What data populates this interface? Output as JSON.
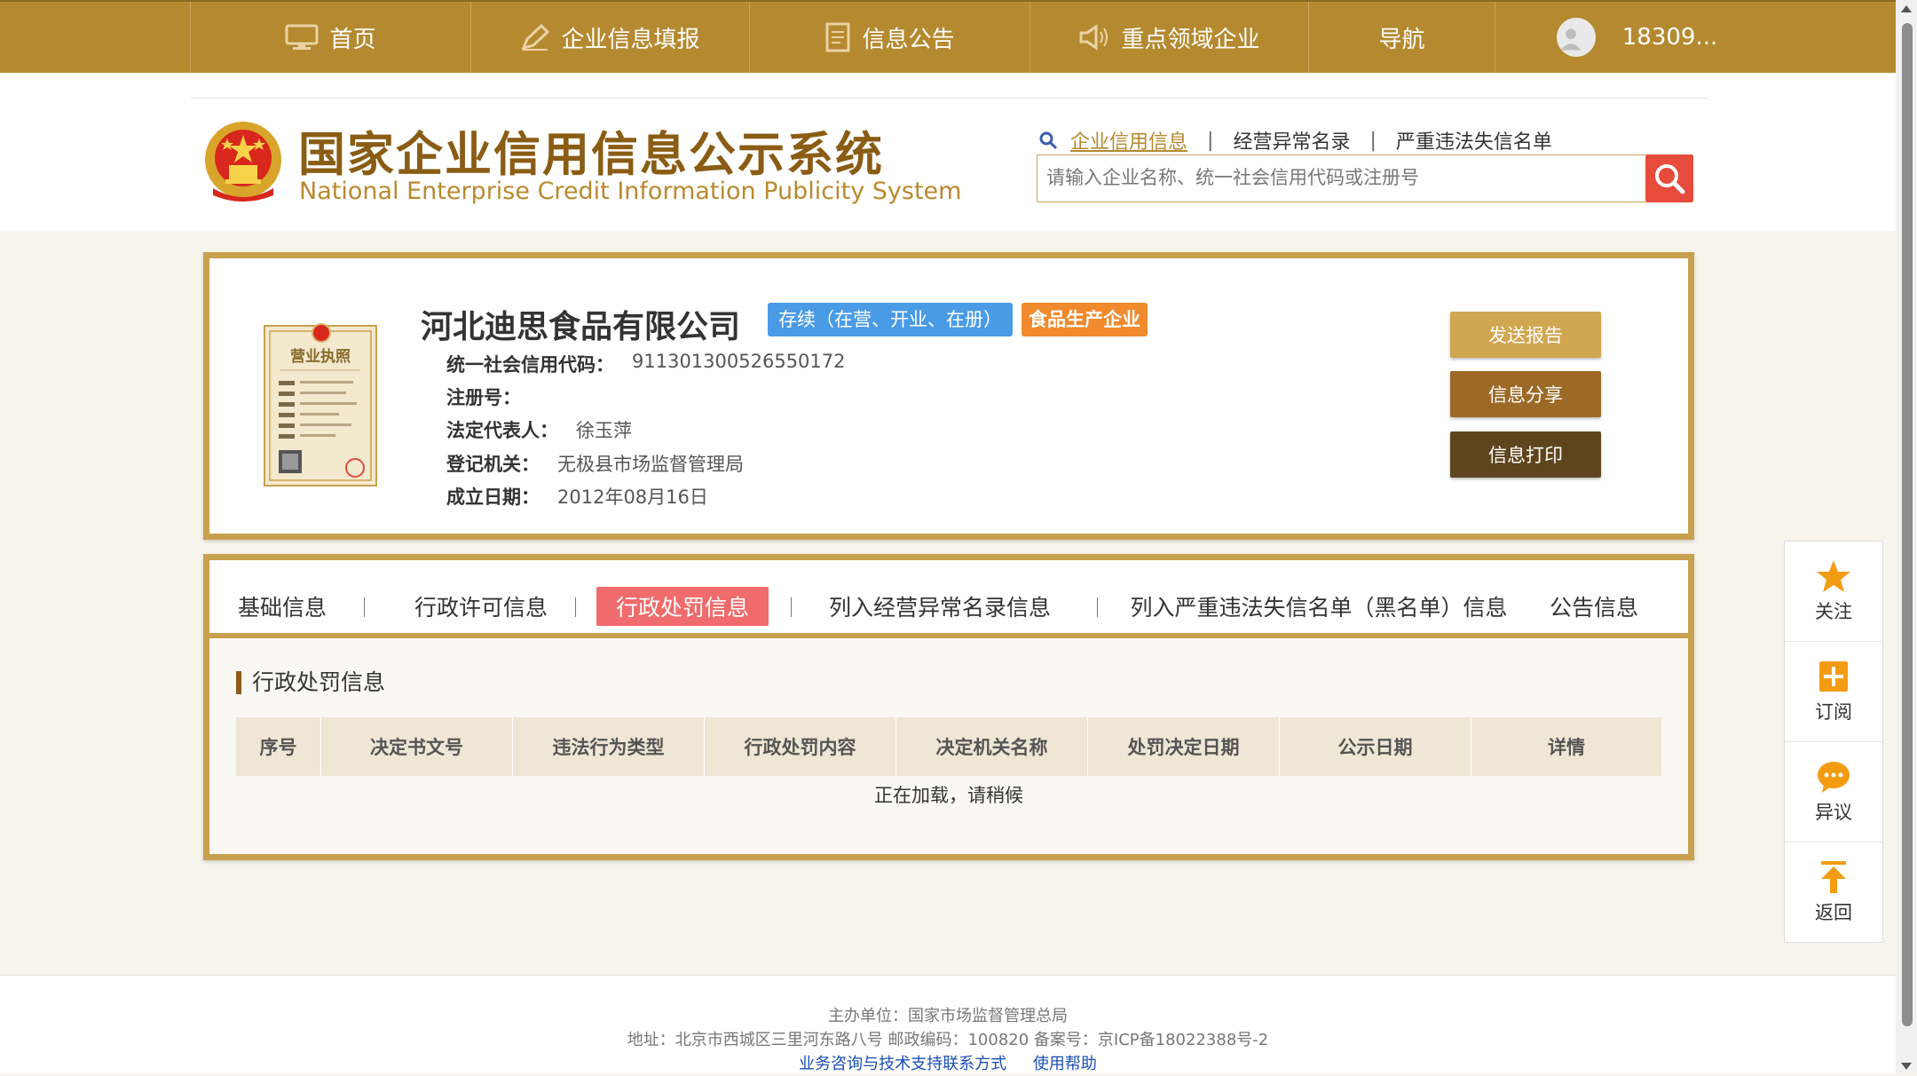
{
  "topnav": {
    "items": [
      {
        "label": "首页",
        "icon": "monitor-icon"
      },
      {
        "label": "企业信息填报",
        "icon": "edit-icon"
      },
      {
        "label": "信息公告",
        "icon": "document-icon"
      },
      {
        "label": "重点领域企业",
        "icon": "speaker-icon"
      },
      {
        "label": "导航"
      }
    ],
    "user": {
      "name": "18309..."
    }
  },
  "header": {
    "title_cn": "国家企业信用信息公示系统",
    "title_en": "National Enterprise Credit Information Publicity System",
    "search_links": [
      "企业信用信息",
      "经营异常名录",
      "严重违法失信名单"
    ],
    "search_placeholder": "请输入企业名称、统一社会信用代码或注册号"
  },
  "company": {
    "name": "河北迪思食品有限公司",
    "status_badge": "存续（在营、开业、在册）",
    "category_badge": "食品生产企业",
    "fields": [
      {
        "label": "统一社会信用代码：",
        "value": "911301300526550172"
      },
      {
        "label": "注册号：",
        "value": ""
      },
      {
        "label": "法定代表人：",
        "value": "徐玉萍"
      },
      {
        "label": "登记机关：",
        "value": "无极县市场监督管理局"
      },
      {
        "label": "成立日期：",
        "value": "2012年08月16日"
      }
    ],
    "license_text": "营业执照",
    "buttons": {
      "send_report": "发送报告",
      "share": "信息分享",
      "print": "信息打印"
    }
  },
  "tabs": {
    "items": [
      "基础信息",
      "行政许可信息",
      "行政处罚信息",
      "列入经营异常名录信息",
      "列入严重违法失信名单（黑名单）信息",
      "公告信息"
    ],
    "active_index": 2
  },
  "penalty_section": {
    "title": "行政处罚信息",
    "columns": [
      "序号",
      "决定书文号",
      "违法行为类型",
      "行政处罚内容",
      "决定机关名称",
      "处罚决定日期",
      "公示日期",
      "详情"
    ],
    "loading_text": "正在加载，请稍候"
  },
  "side_float": {
    "items": [
      {
        "label": "关注",
        "icon": "star-icon"
      },
      {
        "label": "订阅",
        "icon": "plus-icon"
      },
      {
        "label": "异议",
        "icon": "chat-icon"
      },
      {
        "label": "返回",
        "icon": "arrow-up-icon"
      }
    ]
  },
  "footer": {
    "sponsor": "主办单位：国家市场监督管理总局",
    "address": "地址：北京市西城区三里河东路八号   邮政编码：100820   备案号：京ICP备18022388号-2",
    "links": [
      "业务咨询与技术支持联系方式",
      "使用帮助"
    ]
  },
  "colors": {
    "nav_bg": "#b5892f",
    "accent_gold": "#c9a04d",
    "title_brown": "#8a5c14",
    "status_blue": "#4a9be6",
    "food_orange": "#f08a2c",
    "active_tab": "#f06b6b",
    "search_red": "#e64b3b"
  }
}
